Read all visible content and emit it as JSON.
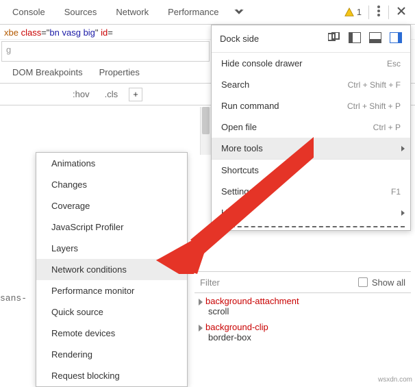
{
  "tabs": {
    "console": "Console",
    "sources": "Sources",
    "network": "Network",
    "performance": "Performance"
  },
  "warning_count": "1",
  "code_fragment": {
    "a": "xbe ",
    "b": "class",
    "c": "=\"",
    "d": "bn vasg big",
    "e": "\" ",
    "f": "id",
    "g": "="
  },
  "inputrow_hint": "g",
  "subtabs": {
    "dom": "DOM Breakpoints",
    "props": "Properties"
  },
  "stylesbar": {
    "hov": ":hov",
    "cls": ".cls",
    "plus": "+"
  },
  "menu": {
    "dock_label": "Dock side",
    "hide_drawer": "Hide console drawer",
    "hide_drawer_hint": "Esc",
    "search": "Search",
    "search_hint": "Ctrl + Shift + F",
    "run_cmd": "Run command",
    "run_cmd_hint": "Ctrl + Shift + P",
    "open_file": "Open file",
    "open_file_hint": "Ctrl + P",
    "more_tools": "More tools",
    "shortcuts": "Shortcuts",
    "settings": "Settings",
    "settings_hint": "F1",
    "help": "Help"
  },
  "submenu": {
    "items": [
      "Animations",
      "Changes",
      "Coverage",
      "JavaScript Profiler",
      "Layers",
      "Network conditions",
      "Performance monitor",
      "Quick source",
      "Remote devices",
      "Rendering",
      "Request blocking"
    ]
  },
  "filter_placeholder": "Filter",
  "showall_label": "Show all",
  "rules": {
    "r1_prop": "background-attachment",
    "r1_val": "scroll",
    "r2_prop": "background-clip",
    "r2_val": "border-box"
  },
  "watermark": "wsxdn.com",
  "left_label": "sans-"
}
